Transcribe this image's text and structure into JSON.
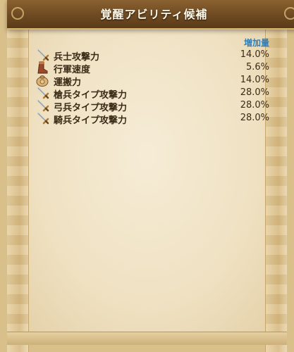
{
  "dialog": {
    "title": "覚醒アビリティ候補",
    "column_header": "増加量",
    "rows": [
      {
        "label": "兵士攻撃力",
        "value": "14.0%",
        "icon": "sword-icon"
      },
      {
        "label": "行軍速度",
        "value": "5.6%",
        "icon": "boot-icon"
      },
      {
        "label": "運搬力",
        "value": "14.0%",
        "icon": "sack-icon"
      },
      {
        "label": "槍兵タイプ攻撃力",
        "value": "28.0%",
        "icon": "sword-icon"
      },
      {
        "label": "弓兵タイプ攻撃力",
        "value": "28.0%",
        "icon": "sword-icon"
      },
      {
        "label": "騎兵タイプ攻撃力",
        "value": "28.0%",
        "icon": "sword-icon"
      }
    ]
  },
  "colors": {
    "title_bar": "#6e4a22",
    "parchment": "#f3e7cc",
    "header_text": "#2f7fb8",
    "body_text": "#3a2a16"
  }
}
